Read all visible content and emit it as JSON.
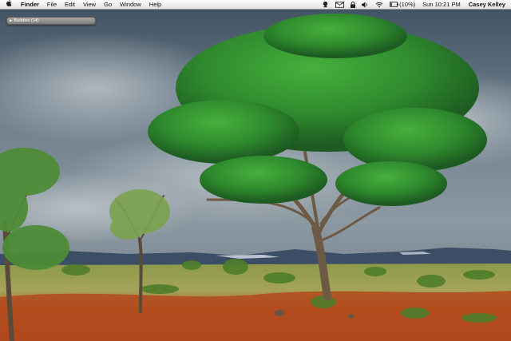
{
  "menubar": {
    "apple_icon": "apple-icon",
    "app_name": "Finder",
    "menus": [
      "File",
      "Edit",
      "View",
      "Go",
      "Window",
      "Help"
    ],
    "status": {
      "battery_text": "(10%)",
      "clock": "Sun 10:21 PM",
      "user": "Casey Kelley"
    }
  },
  "buddy_list": {
    "label": "Buddies (14)",
    "disclosure_icon": "disclosure-triangle-icon"
  },
  "desktop": {
    "wallpaper": "savanna acacia tree under cloudy sky"
  }
}
